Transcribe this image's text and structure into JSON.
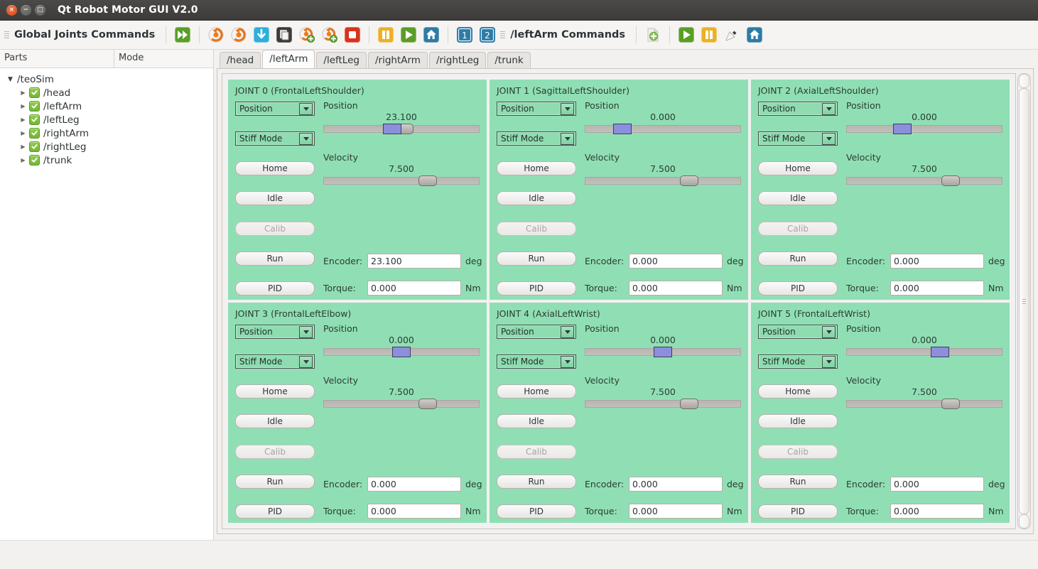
{
  "window": {
    "title": "Qt Robot Motor GUI V2.0",
    "close_label": "×",
    "min_label": "−",
    "max_label": "□"
  },
  "toolbar": {
    "global_label": "Global Joints Commands",
    "part_label": "/leftArm Commands",
    "global_icons": [
      {
        "name": "run-all-icon",
        "title": "Run all parts"
      },
      {
        "name": "home-all-icon-1",
        "title": "Home all parts"
      },
      {
        "name": "home-all-icon-2",
        "title": "Home all parts plus"
      },
      {
        "name": "idle-all-icon",
        "title": "Idle all parts"
      },
      {
        "name": "copy-all-icon",
        "title": "Copy all parts"
      },
      {
        "name": "calib-all-icon-1",
        "title": "Calibrate"
      },
      {
        "name": "calib-all-icon-2",
        "title": "Calibrate plus"
      },
      {
        "name": "stop-all-icon",
        "title": "Stop all"
      },
      {
        "name": "pause-all-icon",
        "title": "Pause all"
      },
      {
        "name": "play-all-icon",
        "title": "Run all"
      },
      {
        "name": "home-icon",
        "title": "Home"
      },
      {
        "name": "seq-1-button",
        "label": "1"
      },
      {
        "name": "seq-2-button",
        "label": "2"
      }
    ],
    "part_icons": [
      {
        "name": "add-part-icon",
        "title": "Add"
      },
      {
        "name": "play-part-icon",
        "title": "Run"
      },
      {
        "name": "pause-part-icon",
        "title": "Pause"
      },
      {
        "name": "calib-part-icon",
        "title": "Calibrate"
      },
      {
        "name": "home-part-icon",
        "title": "Home"
      }
    ]
  },
  "tree": {
    "headers": [
      "Parts",
      "Mode"
    ],
    "root": "/teoSim",
    "items": [
      {
        "label": "/head",
        "checked": true
      },
      {
        "label": "/leftArm",
        "checked": true
      },
      {
        "label": "/leftLeg",
        "checked": true
      },
      {
        "label": "/rightArm",
        "checked": true
      },
      {
        "label": "/rightLeg",
        "checked": true
      },
      {
        "label": "/trunk",
        "checked": true
      }
    ]
  },
  "tabs": [
    {
      "label": "/head",
      "active": false
    },
    {
      "label": "/leftArm",
      "active": true
    },
    {
      "label": "/leftLeg",
      "active": false
    },
    {
      "label": "/rightArm",
      "active": false
    },
    {
      "label": "/rightLeg",
      "active": false
    },
    {
      "label": "/trunk",
      "active": false
    }
  ],
  "labels": {
    "position": "Position",
    "velocity": "Velocity",
    "encoder": "Encoder:",
    "torque": "Torque:",
    "deg": "deg",
    "nm": "Nm",
    "home": "Home",
    "idle": "Idle",
    "calib": "Calib",
    "run": "Run",
    "pid": "PID"
  },
  "colors": {
    "panel_green": "#90dfb4",
    "position_handle": "#8b8fdc",
    "accent_orange": "#dd4814",
    "titlebar": "#3c3b39"
  },
  "joints": [
    {
      "title": "JOINT 0 (FrontalLeftShoulder)",
      "mode": "Position",
      "stiffness": "Stiff Mode",
      "position_value": "23.100",
      "position_pct": 44,
      "position_ghost_pct": 52,
      "velocity_value": "7.500",
      "velocity_pct": 67,
      "encoder": "23.100",
      "torque": "0.000"
    },
    {
      "title": "JOINT 1 (SagittalLeftShoulder)",
      "mode": "Position",
      "stiffness": "Stiff Mode",
      "position_value": "0.000",
      "position_pct": 24,
      "position_ghost_pct": null,
      "velocity_value": "7.500",
      "velocity_pct": 67,
      "encoder": "0.000",
      "torque": "0.000"
    },
    {
      "title": "JOINT 2 (AxialLeftShoulder)",
      "mode": "Position",
      "stiffness": "Stiff Mode",
      "position_value": "0.000",
      "position_pct": 36,
      "position_ghost_pct": null,
      "velocity_value": "7.500",
      "velocity_pct": 67,
      "encoder": "0.000",
      "torque": "0.000"
    },
    {
      "title": "JOINT 3 (FrontalLeftElbow)",
      "mode": "Position",
      "stiffness": "Stiff Mode",
      "position_value": "0.000",
      "position_pct": 50,
      "position_ghost_pct": null,
      "velocity_value": "7.500",
      "velocity_pct": 67,
      "encoder": "0.000",
      "torque": "0.000"
    },
    {
      "title": "JOINT 4 (AxialLeftWrist)",
      "mode": "Position",
      "stiffness": "Stiff Mode",
      "position_value": "0.000",
      "position_pct": 50,
      "position_ghost_pct": null,
      "velocity_value": "7.500",
      "velocity_pct": 67,
      "encoder": "0.000",
      "torque": "0.000"
    },
    {
      "title": "JOINT 5 (FrontalLeftWrist)",
      "mode": "Position",
      "stiffness": "Stiff Mode",
      "position_value": "0.000",
      "position_pct": 60,
      "position_ghost_pct": null,
      "velocity_value": "7.500",
      "velocity_pct": 67,
      "encoder": "0.000",
      "torque": "0.000"
    }
  ]
}
